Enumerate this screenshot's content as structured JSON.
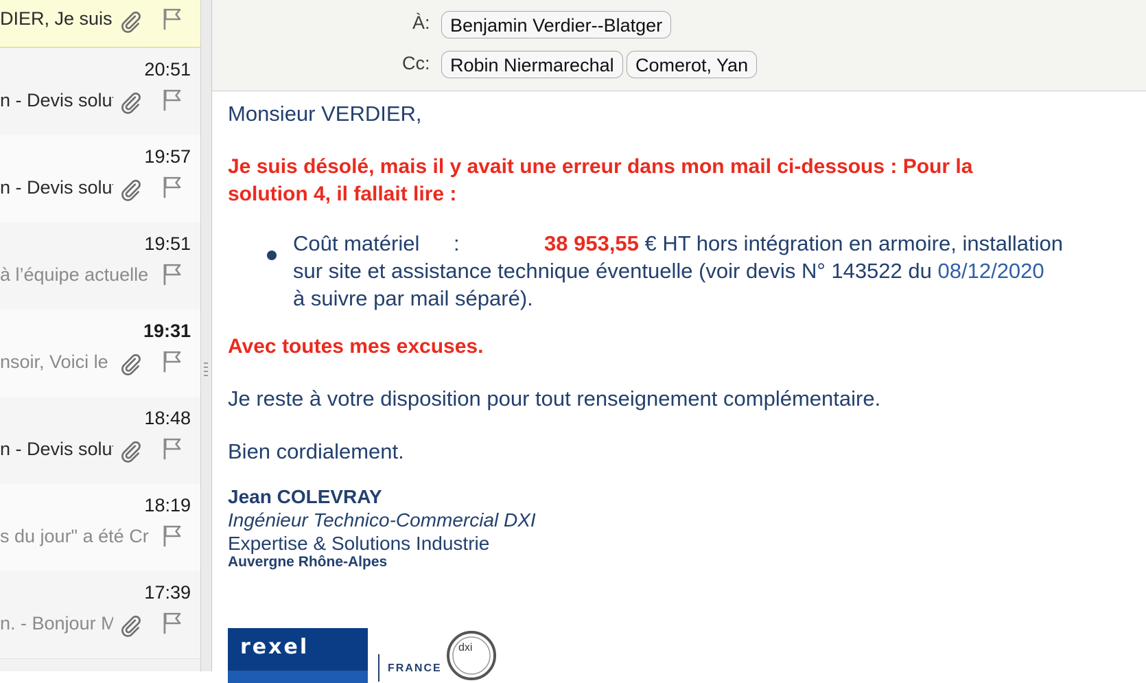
{
  "message_list": {
    "items": [
      {
        "time": "",
        "preview": "DIER, Je suis",
        "preview_grey": false,
        "attachment": true
      },
      {
        "time": "20:51",
        "preview": "n - Devis solution",
        "preview_grey": false,
        "attachment": true
      },
      {
        "time": "19:57",
        "preview": "n - Devis solution",
        "preview_grey": false,
        "attachment": true
      },
      {
        "time": "19:51",
        "preview": "à l’équipe actuelle",
        "preview_grey": true,
        "attachment": false
      },
      {
        "time": "19:31",
        "preview": "nsoir, Voici le",
        "preview_grey": true,
        "attachment": true,
        "unread": true
      },
      {
        "time": "18:48",
        "preview": "n - Devis solution",
        "preview_grey": false,
        "attachment": true
      },
      {
        "time": "18:19",
        "preview": "s du jour\" a été Cr",
        "preview_grey": true,
        "attachment": false
      },
      {
        "time": "17:39",
        "preview": "n. - Bonjour M",
        "preview_grey": true,
        "attachment": true
      }
    ]
  },
  "header": {
    "to_label": "À:",
    "cc_label": "Cc:",
    "to": [
      "Benjamin Verdier--Blatger"
    ],
    "cc": [
      "Robin Niermarechal",
      "Comerot, Yan"
    ]
  },
  "body": {
    "greeting": "Monsieur VERDIER,",
    "warning_line1": "Je suis désolé, mais il y avait une erreur dans mon mail ci-dessous : Pour la",
    "warning_line2": "solution 4, il fallait lire :",
    "bullet_label": "Coût matériel",
    "bullet_colon": ":",
    "bullet_amount": "38 953,55",
    "bullet_line1_rest": " € HT hors intégration en armoire, installation",
    "bullet_line2_text": "sur site et assistance technique éventuelle (voir devis N° 143522 du ",
    "bullet_line2_date": "08/12/2020",
    "bullet_line3": "à suivre par mail séparé).",
    "apology": "Avec toutes mes excuses.",
    "disposition": "Je reste à votre disposition pour tout renseignement complémentaire.",
    "closing": "Bien cordialement.",
    "signature": {
      "name": "Jean COLEVRAY",
      "title": "Ingénieur Technico-Commercial DXI",
      "department": "Expertise & Solutions Industrie",
      "region": "Auvergne Rhône-Alpes"
    },
    "logos": {
      "rexel": "rexel",
      "france": "FRANCE",
      "dxi": "dxi"
    }
  },
  "colors": {
    "body_text": "#23406e",
    "highlight_red": "#ea2b1f",
    "date_link": "#2f5fa7",
    "selected_row": "#fcfcd9"
  }
}
